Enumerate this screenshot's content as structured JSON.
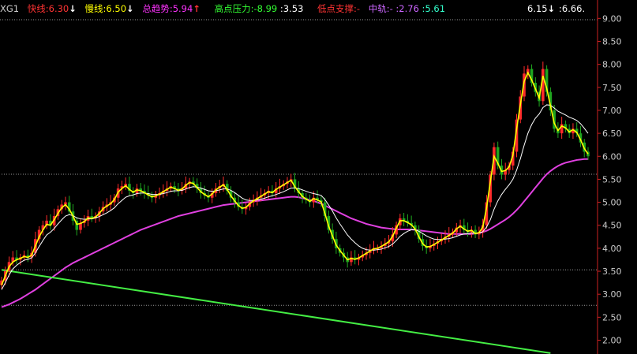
{
  "header": {
    "name": "XG1",
    "fast": {
      "label": "快线:",
      "value": "6.30",
      "arrow": "↓",
      "color": "#ff3333"
    },
    "slow": {
      "label": "慢线:",
      "value": "6.50",
      "arrow": "↓",
      "color": "#ffff00"
    },
    "trend": {
      "label": "总趋势:",
      "value": "5.94",
      "arrow": "↑",
      "color": "#ff33ff"
    },
    "high": {
      "label": "高点压力:-",
      "value1": "8.99",
      "value2": "3.53",
      "color": "#33ff33"
    },
    "low": {
      "label": "低点支撑:-",
      "color": "#ff3333"
    },
    "mid": {
      "label": "中轨:-",
      "value1": "2.76",
      "value2": "5.61",
      "color": "#cc66ff"
    },
    "right1": "6.15",
    "right1_arrow": "↓",
    "right2": "6.66",
    "right2_suffix": "."
  },
  "colors": {
    "up": "#ff2b2b",
    "down": "#1fa61f",
    "fast": "#ffff00",
    "slow": "#ffffff",
    "trend": "#e040e0",
    "support": "#44ee44",
    "grid": "#888888",
    "axis": "#cc2222",
    "tick": "#cccccc"
  },
  "chart_data": {
    "type": "candlestick",
    "ylim": [
      1.7,
      9.4
    ],
    "yticks": [
      "9.00",
      "8.50",
      "8.00",
      "7.50",
      "7.00",
      "6.50",
      "6.00",
      "5.50",
      "5.00",
      "4.50",
      "4.00",
      "3.50",
      "3.00",
      "2.50",
      "2.00"
    ],
    "ytick_values": [
      9.0,
      8.5,
      8.0,
      7.5,
      7.0,
      6.5,
      6.0,
      5.5,
      5.0,
      4.5,
      4.0,
      3.5,
      3.0,
      2.5,
      2.0
    ],
    "dashed_levels": [
      5.61,
      3.53,
      2.76
    ],
    "closes": [
      3.3,
      3.5,
      3.7,
      3.8,
      3.75,
      3.8,
      3.85,
      3.8,
      3.9,
      4.2,
      4.4,
      4.5,
      4.6,
      4.5,
      4.7,
      4.85,
      4.95,
      5.0,
      4.8,
      4.6,
      4.4,
      4.55,
      4.6,
      4.7,
      4.65,
      4.7,
      4.8,
      4.9,
      4.95,
      5.0,
      5.1,
      5.3,
      5.35,
      5.4,
      5.25,
      5.2,
      5.3,
      5.25,
      5.2,
      5.15,
      5.1,
      5.15,
      5.2,
      5.25,
      5.3,
      5.35,
      5.3,
      5.25,
      5.3,
      5.4,
      5.45,
      5.4,
      5.3,
      5.2,
      5.15,
      5.1,
      5.2,
      5.3,
      5.35,
      5.4,
      5.25,
      5.1,
      5.0,
      4.9,
      4.85,
      4.9,
      5.0,
      5.05,
      5.1,
      5.15,
      5.2,
      5.25,
      5.2,
      5.3,
      5.35,
      5.4,
      5.45,
      5.5,
      5.3,
      5.2,
      5.1,
      5.05,
      5.0,
      5.1,
      5.05,
      5.0,
      4.7,
      4.4,
      4.2,
      4.0,
      3.9,
      3.8,
      3.7,
      3.8,
      3.75,
      3.8,
      3.85,
      3.9,
      3.95,
      4.0,
      4.0,
      4.05,
      4.1,
      4.15,
      4.3,
      4.5,
      4.65,
      4.6,
      4.55,
      4.5,
      4.4,
      4.2,
      4.05,
      4.0,
      4.05,
      4.1,
      4.15,
      4.2,
      4.25,
      4.3,
      4.35,
      4.45,
      4.5,
      4.4,
      4.35,
      4.4,
      4.3,
      4.35,
      4.5,
      5.0,
      5.6,
      6.2,
      5.8,
      5.6,
      5.7,
      5.8,
      6.1,
      6.8,
      7.3,
      7.8,
      7.9,
      7.6,
      7.4,
      7.2,
      7.9,
      7.4,
      7.0,
      6.6,
      6.5,
      6.7,
      6.6,
      6.5,
      6.6,
      6.5,
      6.3,
      6.1,
      6.0
    ],
    "fast_line": [
      3.2,
      3.4,
      3.6,
      3.7,
      3.75,
      3.78,
      3.82,
      3.8,
      3.85,
      4.05,
      4.25,
      4.4,
      4.52,
      4.5,
      4.62,
      4.76,
      4.88,
      4.95,
      4.85,
      4.7,
      4.52,
      4.54,
      4.58,
      4.66,
      4.65,
      4.68,
      4.76,
      4.86,
      4.92,
      4.97,
      5.06,
      5.22,
      5.3,
      5.36,
      5.28,
      5.22,
      5.27,
      5.25,
      5.21,
      5.16,
      5.12,
      5.14,
      5.18,
      5.23,
      5.28,
      5.33,
      5.3,
      5.26,
      5.29,
      5.37,
      5.43,
      5.41,
      5.32,
      5.23,
      5.17,
      5.12,
      5.18,
      5.27,
      5.33,
      5.38,
      5.28,
      5.14,
      5.03,
      4.93,
      4.87,
      4.89,
      4.97,
      5.03,
      5.08,
      5.13,
      5.18,
      5.23,
      5.21,
      5.28,
      5.33,
      5.38,
      5.43,
      5.48,
      5.34,
      5.23,
      5.13,
      5.07,
      5.02,
      5.08,
      5.05,
      5.01,
      4.76,
      4.48,
      4.27,
      4.07,
      3.95,
      3.85,
      3.75,
      3.78,
      3.76,
      3.79,
      3.84,
      3.89,
      3.94,
      3.99,
      4.0,
      4.04,
      4.09,
      4.14,
      4.26,
      4.44,
      4.6,
      4.6,
      4.56,
      4.51,
      4.42,
      4.25,
      4.1,
      4.03,
      4.04,
      4.08,
      4.13,
      4.18,
      4.23,
      4.28,
      4.33,
      4.42,
      4.48,
      4.42,
      4.37,
      4.39,
      4.32,
      4.34,
      4.46,
      4.88,
      5.44,
      6.0,
      5.85,
      5.67,
      5.69,
      5.77,
      6.02,
      6.6,
      7.13,
      7.63,
      7.82,
      7.66,
      7.47,
      7.27,
      7.75,
      7.48,
      7.1,
      6.72,
      6.56,
      6.66,
      6.62,
      6.53,
      6.58,
      6.52,
      6.36,
      6.17,
      6.05
    ],
    "slow_line": [
      3.1,
      3.25,
      3.42,
      3.55,
      3.63,
      3.69,
      3.74,
      3.76,
      3.79,
      3.9,
      4.04,
      4.17,
      4.29,
      4.35,
      4.43,
      4.53,
      4.62,
      4.7,
      4.73,
      4.71,
      4.66,
      4.64,
      4.63,
      4.64,
      4.64,
      4.66,
      4.69,
      4.73,
      4.77,
      4.82,
      4.88,
      4.97,
      5.04,
      5.11,
      5.14,
      5.16,
      5.19,
      5.2,
      5.2,
      5.19,
      5.17,
      5.17,
      5.17,
      5.19,
      5.21,
      5.24,
      5.25,
      5.25,
      5.26,
      5.29,
      5.32,
      5.34,
      5.33,
      5.31,
      5.28,
      5.25,
      5.24,
      5.25,
      5.27,
      5.29,
      5.29,
      5.26,
      5.21,
      5.15,
      5.09,
      5.05,
      5.04,
      5.04,
      5.05,
      5.07,
      5.09,
      5.12,
      5.14,
      5.17,
      5.2,
      5.23,
      5.27,
      5.31,
      5.31,
      5.3,
      5.27,
      5.24,
      5.21,
      5.19,
      5.17,
      5.15,
      5.06,
      4.94,
      4.81,
      4.66,
      4.53,
      4.41,
      4.29,
      4.2,
      4.12,
      4.05,
      4.0,
      3.97,
      3.96,
      3.96,
      3.97,
      3.98,
      4.01,
      4.04,
      4.09,
      4.17,
      4.26,
      4.32,
      4.37,
      4.4,
      4.4,
      4.37,
      4.32,
      4.27,
      4.23,
      4.2,
      4.19,
      4.19,
      4.2,
      4.21,
      4.23,
      4.26,
      4.29,
      4.31,
      4.32,
      4.33,
      4.33,
      4.33,
      4.36,
      4.46,
      4.62,
      4.85,
      5.03,
      5.17,
      5.28,
      5.38,
      5.5,
      5.7,
      5.95,
      6.24,
      6.5,
      6.69,
      6.83,
      6.92,
      7.06,
      7.12,
      7.11,
      7.05,
      6.98,
      6.94,
      6.9,
      6.85,
      6.82,
      6.78,
      6.71,
      6.61,
      6.5
    ],
    "trend_line": [
      2.72,
      2.75,
      2.78,
      2.82,
      2.86,
      2.9,
      2.95,
      3.0,
      3.05,
      3.1,
      3.16,
      3.22,
      3.28,
      3.34,
      3.4,
      3.46,
      3.52,
      3.58,
      3.63,
      3.68,
      3.72,
      3.76,
      3.8,
      3.84,
      3.88,
      3.92,
      3.96,
      4.0,
      4.04,
      4.08,
      4.12,
      4.16,
      4.2,
      4.24,
      4.28,
      4.32,
      4.36,
      4.4,
      4.43,
      4.46,
      4.49,
      4.52,
      4.55,
      4.58,
      4.61,
      4.64,
      4.67,
      4.7,
      4.72,
      4.74,
      4.76,
      4.78,
      4.8,
      4.82,
      4.84,
      4.86,
      4.88,
      4.9,
      4.92,
      4.94,
      4.95,
      4.96,
      4.97,
      4.98,
      4.99,
      5.0,
      5.01,
      5.02,
      5.03,
      5.04,
      5.05,
      5.06,
      5.07,
      5.08,
      5.09,
      5.1,
      5.11,
      5.12,
      5.12,
      5.11,
      5.09,
      5.07,
      5.05,
      5.03,
      5.0,
      4.97,
      4.93,
      4.89,
      4.85,
      4.81,
      4.77,
      4.73,
      4.69,
      4.65,
      4.62,
      4.59,
      4.56,
      4.53,
      4.51,
      4.49,
      4.47,
      4.45,
      4.44,
      4.43,
      4.42,
      4.41,
      4.41,
      4.41,
      4.41,
      4.41,
      4.4,
      4.39,
      4.38,
      4.37,
      4.36,
      4.35,
      4.34,
      4.33,
      4.32,
      4.31,
      4.31,
      4.31,
      4.31,
      4.31,
      4.31,
      4.31,
      4.32,
      4.33,
      4.35,
      4.38,
      4.42,
      4.47,
      4.52,
      4.57,
      4.62,
      4.68,
      4.75,
      4.83,
      4.92,
      5.02,
      5.12,
      5.22,
      5.32,
      5.42,
      5.52,
      5.61,
      5.68,
      5.74,
      5.79,
      5.83,
      5.86,
      5.88,
      5.9,
      5.92,
      5.93,
      5.94,
      5.94
    ],
    "support_line": {
      "x0": 0,
      "y0": 3.53,
      "x1": 146,
      "y1": 1.72
    }
  }
}
